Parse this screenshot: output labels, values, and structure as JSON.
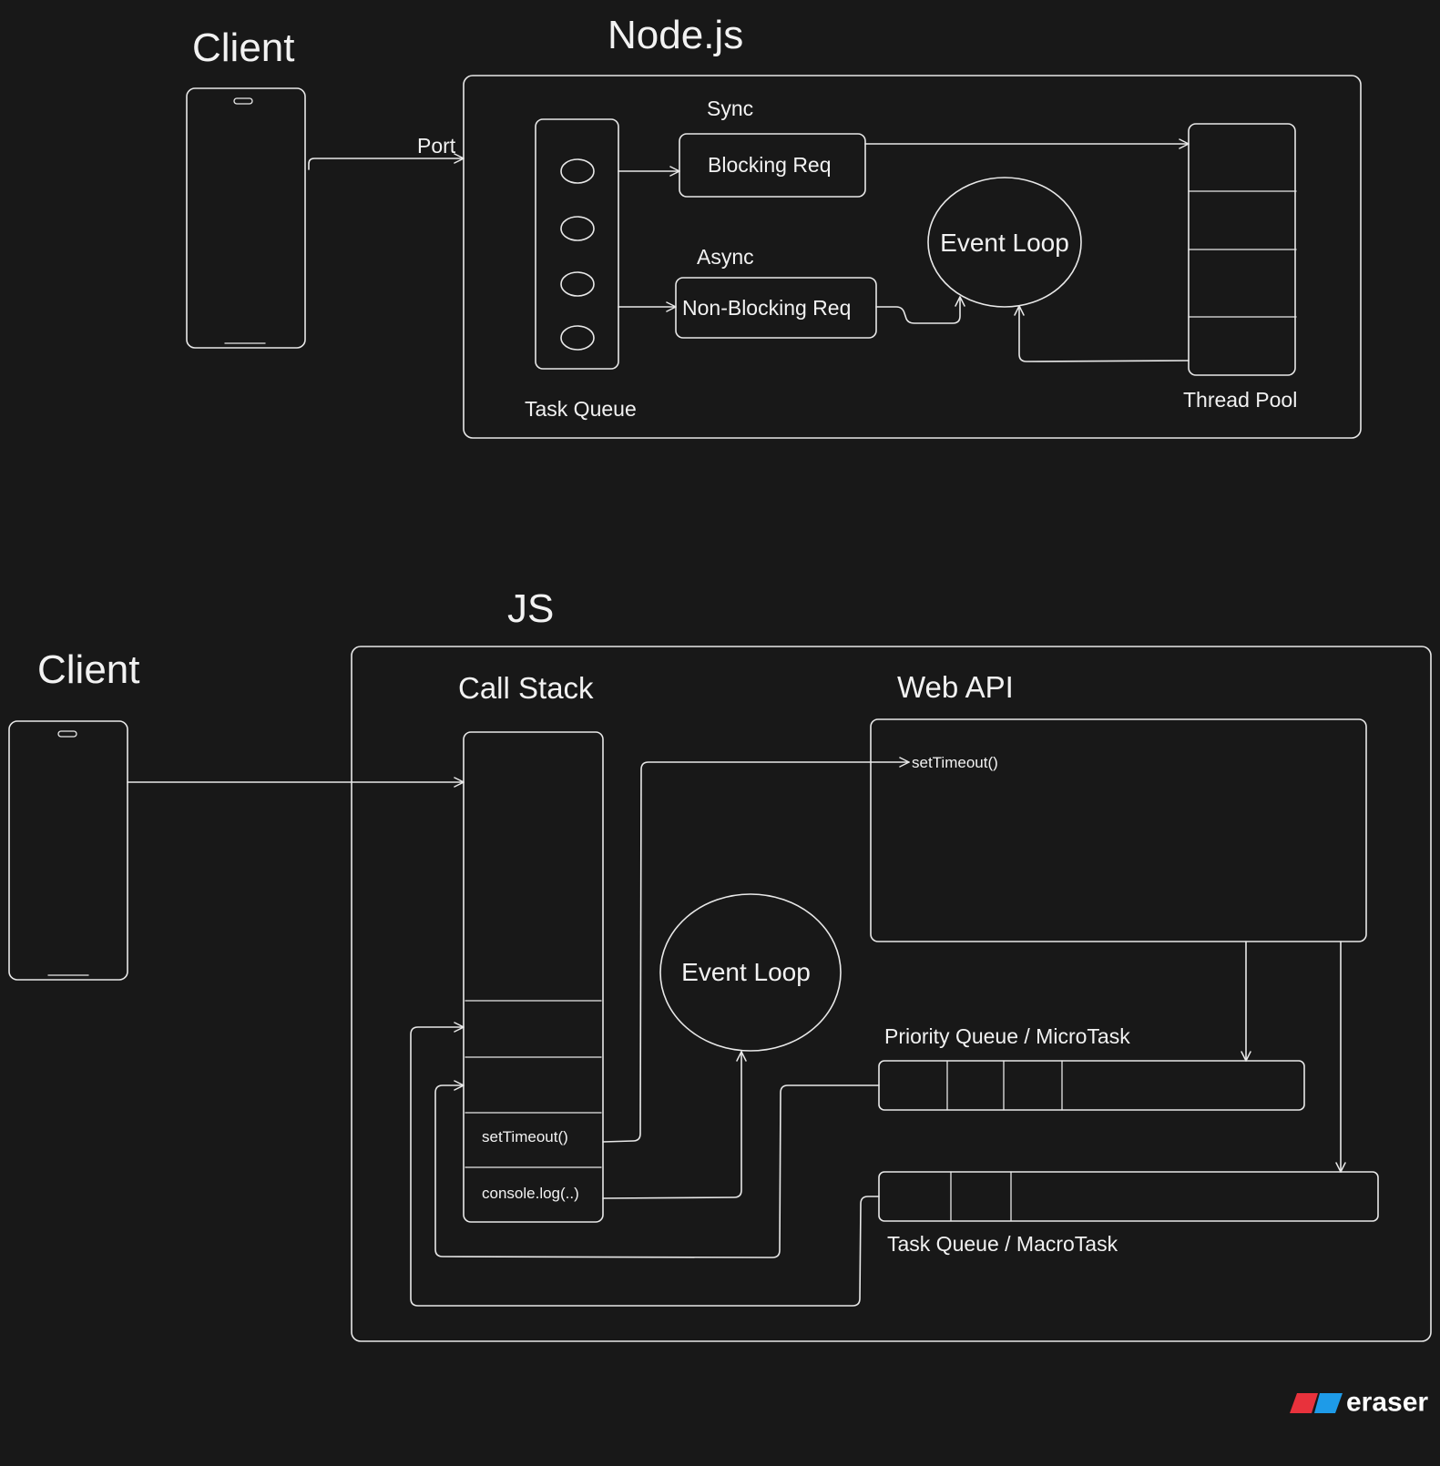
{
  "nodejs": {
    "client_label": "Client",
    "title": "Node.js",
    "port_label": "Port",
    "sync_label": "Sync",
    "blocking_req": "Blocking Req",
    "async_label": "Async",
    "non_blocking_req": "Non-Blocking Req",
    "event_loop": "Event Loop",
    "task_queue": "Task Queue",
    "thread_pool": "Thread Pool"
  },
  "js": {
    "client_label": "Client",
    "title": "JS",
    "call_stack": "Call Stack",
    "web_api": "Web API",
    "web_api_item": "setTimeout()",
    "event_loop": "Event Loop",
    "stack_item_1": "setTimeout()",
    "stack_item_2": "console.log(..)",
    "priority_queue": "Priority Queue / MicroTask",
    "task_queue": "Task Queue / MacroTask"
  },
  "brand": {
    "name": "eraser",
    "colors": {
      "red": "#e8323c",
      "blue": "#1e9be8"
    }
  }
}
